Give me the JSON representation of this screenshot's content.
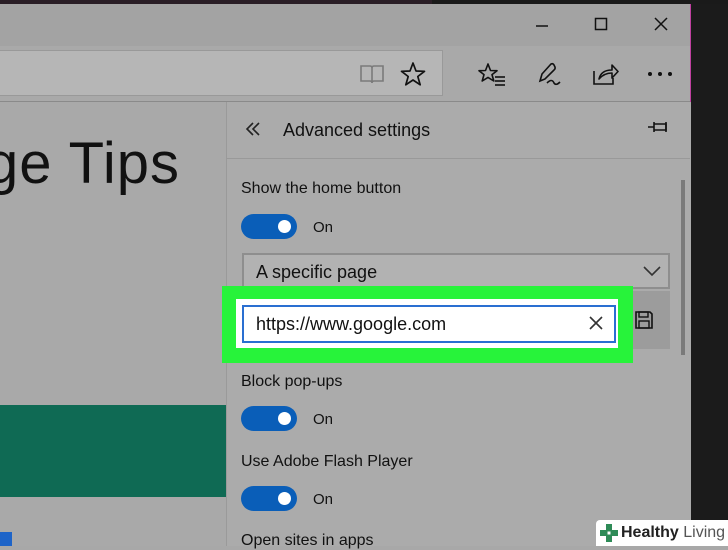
{
  "browser": {
    "page_heading_fragment": "ge Tips"
  },
  "settings": {
    "title": "Advanced settings",
    "home_button": {
      "label": "Show the home button",
      "state": "On",
      "select_value": "A specific page",
      "url_value": "https://www.google.com"
    },
    "popups": {
      "label": "Block pop-ups",
      "state": "On"
    },
    "flash": {
      "label": "Use Adobe Flash Player",
      "state": "On"
    },
    "open_in_apps": {
      "label": "Open sites in apps"
    }
  },
  "watermark": {
    "brand": "Healthy",
    "brand_light": "Living"
  },
  "colors": {
    "toggle_on": "#0a5eb8",
    "highlight": "#27f33a",
    "input_border": "#2a6fd1",
    "page_band": "#0f6a54"
  },
  "icons": {
    "minimize": "minimize-icon",
    "maximize": "maximize-icon",
    "close": "close-icon",
    "reading_view": "reading-view-icon",
    "favorite": "star-icon",
    "hub": "favorites-list-icon",
    "notes": "pen-icon",
    "share": "share-icon",
    "more": "more-icon",
    "back": "double-chevron-left-icon",
    "pin": "pin-icon",
    "dropdown": "chevron-down-icon",
    "clear": "close-icon",
    "save": "save-icon"
  }
}
